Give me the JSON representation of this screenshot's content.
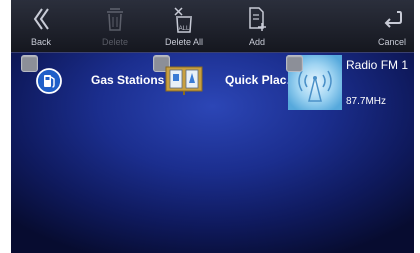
{
  "toolbar": {
    "back_label": "Back",
    "delete_label": "Delete",
    "delete_all_label": "Delete All",
    "add_label": "Add",
    "cancel_label": "Cancel"
  },
  "items": [
    {
      "label": "Gas Stations",
      "icon": "gas-station-icon"
    },
    {
      "label": "Quick Plac…",
      "icon": "quick-places-icon"
    },
    {
      "label": "Radio FM 1",
      "sublabel": "87.7MHz",
      "icon": "radio-antenna-icon"
    }
  ],
  "colors": {
    "background_center": "#2c46b6",
    "background_edge": "#070c30",
    "toolbar": "#1f222c",
    "checkbox": "#8c8f98"
  }
}
